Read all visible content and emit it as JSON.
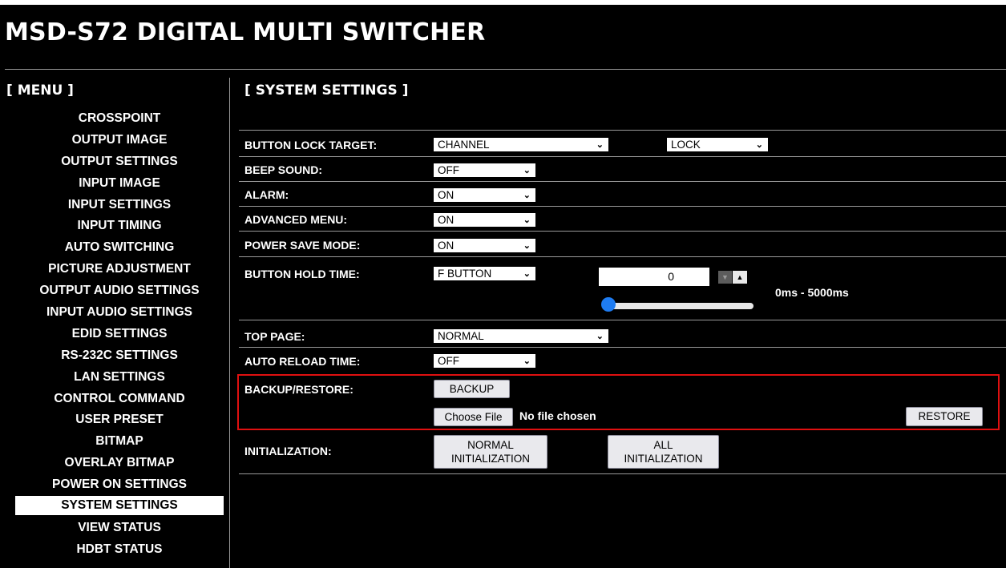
{
  "app": {
    "title": "MSD-S72 DIGITAL MULTI SWITCHER"
  },
  "menu": {
    "heading": "[ MENU ]",
    "items": [
      {
        "label": "CROSSPOINT"
      },
      {
        "label": "OUTPUT IMAGE"
      },
      {
        "label": "OUTPUT SETTINGS"
      },
      {
        "label": "INPUT IMAGE"
      },
      {
        "label": "INPUT SETTINGS"
      },
      {
        "label": "INPUT TIMING"
      },
      {
        "label": "AUTO SWITCHING"
      },
      {
        "label": "PICTURE ADJUSTMENT"
      },
      {
        "label": "OUTPUT AUDIO SETTINGS"
      },
      {
        "label": "INPUT AUDIO SETTINGS"
      },
      {
        "label": "EDID SETTINGS"
      },
      {
        "label": "RS-232C SETTINGS"
      },
      {
        "label": "LAN SETTINGS"
      },
      {
        "label": "CONTROL COMMAND"
      },
      {
        "label": "USER PRESET"
      },
      {
        "label": "BITMAP"
      },
      {
        "label": "OVERLAY BITMAP"
      },
      {
        "label": "POWER ON SETTINGS"
      },
      {
        "label": "SYSTEM SETTINGS",
        "active": true
      },
      {
        "label": "VIEW STATUS"
      },
      {
        "label": "HDBT STATUS"
      }
    ]
  },
  "page": {
    "title": "[ SYSTEM SETTINGS ]",
    "button_lock_target": {
      "label": "BUTTON LOCK TARGET:",
      "target_value": "CHANNEL",
      "lock_value": "LOCK"
    },
    "beep_sound": {
      "label": "BEEP SOUND:",
      "value": "OFF"
    },
    "alarm": {
      "label": "ALARM:",
      "value": "ON"
    },
    "advanced_menu": {
      "label": "ADVANCED MENU:",
      "value": "ON"
    },
    "power_save_mode": {
      "label": "POWER SAVE MODE:",
      "value": "ON"
    },
    "button_hold_time": {
      "label": "BUTTON HOLD TIME:",
      "button_value": "F BUTTON",
      "time_value": "0",
      "range_text": "0ms - 5000ms",
      "slider_fraction": 0
    },
    "top_page": {
      "label": "TOP PAGE:",
      "value": "NORMAL"
    },
    "auto_reload_time": {
      "label": "AUTO RELOAD TIME:",
      "value": "OFF"
    },
    "backup_restore": {
      "label": "BACKUP/RESTORE:",
      "backup_button": "BACKUP",
      "choose_file_button": "Choose File",
      "file_status": "No file chosen",
      "restore_button": "RESTORE"
    },
    "initialization": {
      "label": "INITIALIZATION:",
      "normal_line1": "NORMAL",
      "normal_line2": "INITIALIZATION",
      "all_line1": "ALL",
      "all_line2": "INITIALIZATION"
    }
  },
  "colors": {
    "background": "#000000",
    "text": "#ffffff",
    "highlight_border": "#e01010",
    "slider_thumb": "#1e7cf2"
  }
}
